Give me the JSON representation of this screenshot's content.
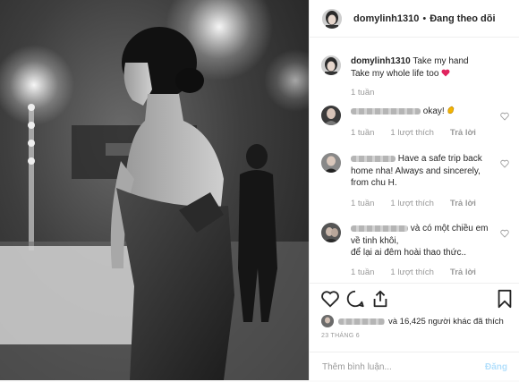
{
  "header": {
    "username": "domylinh1310",
    "separator": "•",
    "follow_status": "Đang theo dõi"
  },
  "caption": {
    "username": "domylinh1310",
    "line1": "Take my hand",
    "line2": "Take my whole life too",
    "emoji": "heart-icon",
    "time": "1 tuần"
  },
  "comments": [
    {
      "text": "okay!",
      "emoji": "clapping-hands-icon",
      "time": "1 tuần",
      "likes": "1 lượt thích",
      "reply": "Trả lời"
    },
    {
      "text": "Have a safe trip back home nha! Always and sincerely, from chu H.",
      "time": "1 tuần",
      "likes": "1 lượt thích",
      "reply": "Trả lời"
    },
    {
      "line1": "và có một chiều em về tinh khôi,",
      "line2": "để lại ai đêm hoài thao thức..",
      "time": "1 tuần",
      "likes": "1 lượt thích",
      "reply": "Trả lời"
    }
  ],
  "likes": {
    "text": "và 16,425 người khác đã thích"
  },
  "date": "23 THÁNG 6",
  "add_comment": {
    "placeholder": "Thêm bình luận...",
    "post_label": "Đăng"
  },
  "colors": {
    "heart": "#e0245e",
    "post_disabled": "#b2dffc",
    "secondary_text": "#999999"
  }
}
